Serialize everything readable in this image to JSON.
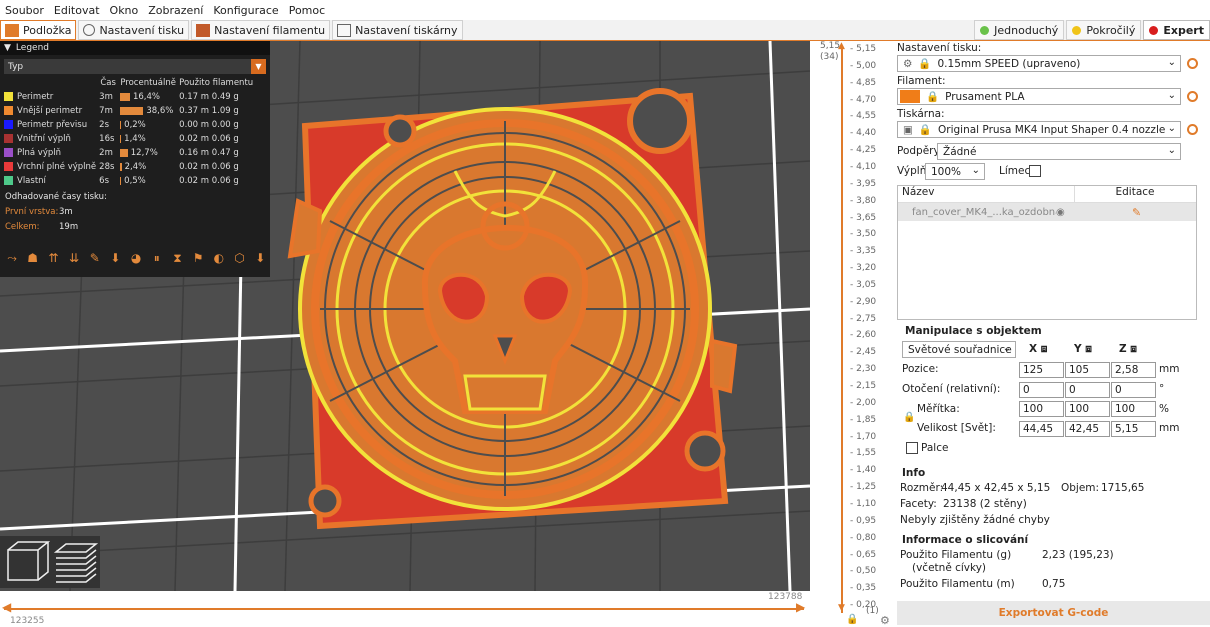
{
  "menu": [
    "Soubor",
    "Editovat",
    "Okno",
    "Zobrazení",
    "Konfigurace",
    "Pomoc"
  ],
  "tabs": [
    "Podložka",
    "Nastavení tisku",
    "Nastavení filamentu",
    "Nastavení tiskárny"
  ],
  "modes": [
    {
      "label": "Jednoduchý",
      "color": "#6ac24a"
    },
    {
      "label": "Pokročilý",
      "color": "#f0c419"
    },
    {
      "label": "Expert",
      "color": "#d81e1e"
    }
  ],
  "legend": {
    "header": "Legend",
    "selector": "Typ",
    "columns": [
      "Čas",
      "Procentuálně",
      "Použito filamentu"
    ],
    "rows": [
      {
        "name": "Perimetr",
        "color": "#f2e23a",
        "time": "3m",
        "pct": "16,4%",
        "pct_value": 16.4,
        "len": "0.17 m",
        "weight": "0.49 g"
      },
      {
        "name": "Vnější perimetr",
        "color": "#f08a30",
        "time": "7m",
        "pct": "38,6%",
        "pct_value": 38.6,
        "len": "0.37 m",
        "weight": "1.09 g"
      },
      {
        "name": "Perimetr převisu",
        "color": "#1a1aff",
        "time": "2s",
        "pct": "0,2%",
        "pct_value": 0.2,
        "len": "0.00 m",
        "weight": "0.00 g"
      },
      {
        "name": "Vnitřní výplň",
        "color": "#a83232",
        "time": "16s",
        "pct": "1,4%",
        "pct_value": 1.4,
        "len": "0.02 m",
        "weight": "0.06 g"
      },
      {
        "name": "Plná výplň",
        "color": "#9a4fc8",
        "time": "2m",
        "pct": "12,7%",
        "pct_value": 12.7,
        "len": "0.16 m",
        "weight": "0.47 g"
      },
      {
        "name": "Vrchní plné výplně",
        "color": "#e83a3a",
        "time": "28s",
        "pct": "2,4%",
        "pct_value": 2.4,
        "len": "0.02 m",
        "weight": "0.06 g"
      },
      {
        "name": "Vlastní",
        "color": "#4ec98a",
        "time": "6s",
        "pct": "0,5%",
        "pct_value": 0.5,
        "len": "0.02 m",
        "weight": "0.06 g"
      }
    ],
    "estimates_title": "Odhadované časy tisku:",
    "first_layer_label": "První vrstva:",
    "first_layer_value": "3m",
    "total_label": "Celkem:",
    "total_value": "19m"
  },
  "ruler": {
    "top_value": "5,15",
    "top_layer": "(34)",
    "bottom_value": "0,20",
    "bottom_layer": "(1)",
    "ticks": [
      "5,15",
      "5,00",
      "4,85",
      "4,70",
      "4,55",
      "4,40",
      "4,25",
      "4,10",
      "3,95",
      "3,80",
      "3,65",
      "3,50",
      "3,35",
      "3,20",
      "3,05",
      "2,90",
      "2,75",
      "2,60",
      "2,45",
      "2,30",
      "2,15",
      "2,00",
      "1,85",
      "1,70",
      "1,55",
      "1,40",
      "1,25",
      "1,10",
      "0,95",
      "0,80",
      "0,65",
      "0,50",
      "0,35",
      "0,20"
    ]
  },
  "horizontal_slider": {
    "left": "123255",
    "right": "123788"
  },
  "sidebar": {
    "print_settings_label": "Nastavení tisku:",
    "print_settings_value": "0.15mm SPEED (upraveno)",
    "filament_label": "Filament:",
    "filament_value": "Prusament PLA",
    "filament_color": "#f07d18",
    "printer_label": "Tiskárna:",
    "printer_value": "Original Prusa MK4 Input Shaper 0.4 nozzle",
    "supports_label": "Podpěry:",
    "supports_value": "Žádné",
    "infill_label": "Výplň:",
    "infill_value": "100%",
    "brim_label": "Límec:",
    "objlist_name": "Název",
    "objlist_edit": "Editace",
    "object_name": "fan_cover_MK4_...ka_ozdobna.stl",
    "manip_title": "Manipulace s objektem",
    "coord_mode": "Světové souřadnice",
    "axis_x": "X",
    "axis_y": "Y",
    "axis_z": "Z",
    "position_label": "Pozice:",
    "position": [
      "125",
      "105",
      "2,58"
    ],
    "position_unit": "mm",
    "rotation_label": "Otočení (relativní):",
    "rotation": [
      "0",
      "0",
      "0"
    ],
    "rotation_unit": "°",
    "scale_label": "Měřítka:",
    "scale": [
      "100",
      "100",
      "100"
    ],
    "scale_unit": "%",
    "size_label": "Velikost [Svět]:",
    "size": [
      "44,45",
      "42,45",
      "5,15"
    ],
    "size_unit": "mm",
    "inches_label": "Palce",
    "info_title": "Info",
    "size_info_label": "Rozměr:",
    "size_info_value": "44,45 x 42,45 x 5,15",
    "volume_label": "Objem:",
    "volume_value": "1715,65",
    "facets_label": "Facety:",
    "facets_value": "23138 (2 stěny)",
    "errors_text": "Nebyly zjištěny žádné chyby",
    "slice_title": "Informace o slicování",
    "filament_g_label": "Použito Filamentu (g)",
    "filament_g_sub": "(včetně cívky)",
    "filament_g_value": "2,23 (195,23)",
    "filament_m_label": "Použito Filamentu (m)",
    "filament_m_value": "0,75",
    "export_label": "Exportovat G-code"
  }
}
